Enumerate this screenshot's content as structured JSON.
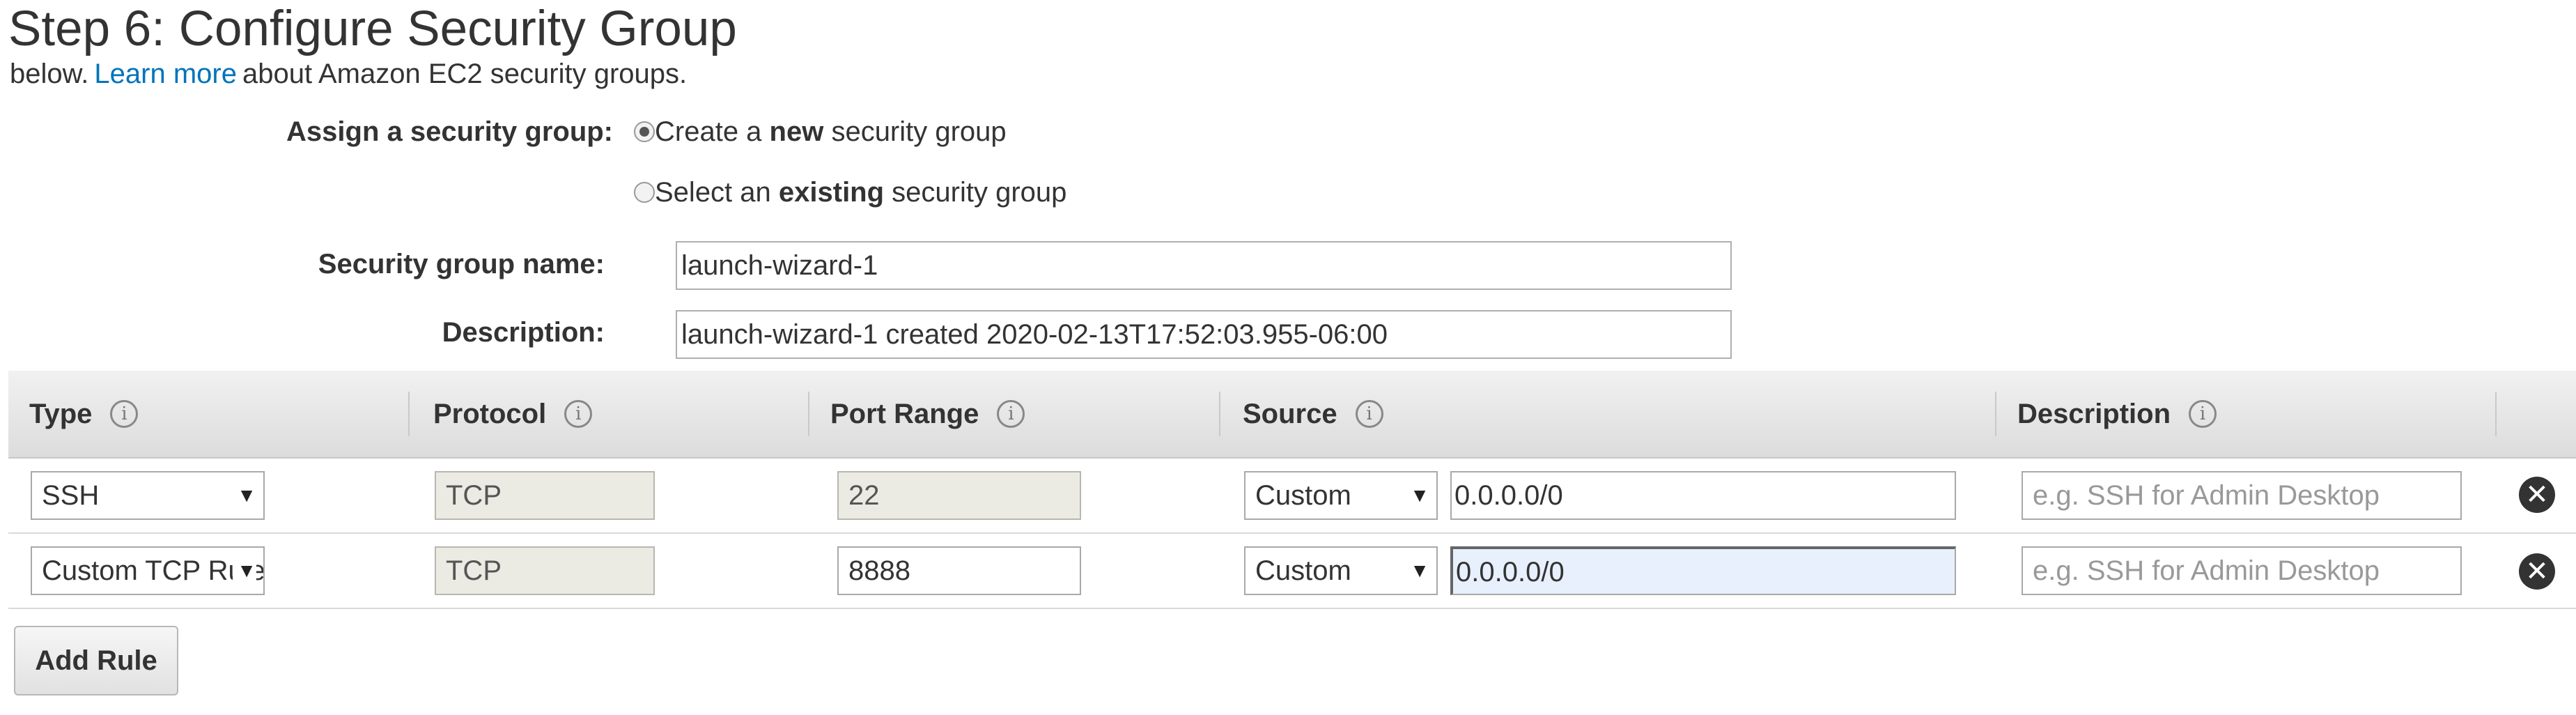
{
  "page": {
    "title": "Step 6: Configure Security Group",
    "intro_prefix": "below.",
    "learn_more": "Learn more",
    "intro_suffix": "about Amazon EC2 security groups."
  },
  "assign": {
    "label": "Assign a security group:",
    "create_prefix": "Create a ",
    "create_bold": "new",
    "create_suffix": " security group",
    "select_prefix": "Select an ",
    "select_bold": "existing",
    "select_suffix": " security group",
    "selected": "create"
  },
  "group": {
    "name_label": "Security group name:",
    "name_value": "launch-wizard-1",
    "desc_label": "Description:",
    "desc_value": "launch-wizard-1 created 2020-02-13T17:52:03.955-06:00"
  },
  "table": {
    "headers": [
      "Type",
      "Protocol",
      "Port Range",
      "Source",
      "Description"
    ],
    "rows": [
      {
        "type": "SSH",
        "protocol": "TCP",
        "port": "22",
        "source_mode": "Custom",
        "source_cidr": "0.0.0.0/0",
        "description_placeholder": "e.g. SSH for Admin Desktop"
      },
      {
        "type": "Custom TCP Rule",
        "protocol": "TCP",
        "port": "8888",
        "source_mode": "Custom",
        "source_cidr": "0.0.0.0/0",
        "description_placeholder": "e.g. SSH for Admin Desktop"
      }
    ]
  },
  "actions": {
    "add_rule": "Add Rule"
  },
  "icons": {
    "info": "info-icon",
    "remove": "remove-icon",
    "dropdown": "chevron-down-icon"
  }
}
